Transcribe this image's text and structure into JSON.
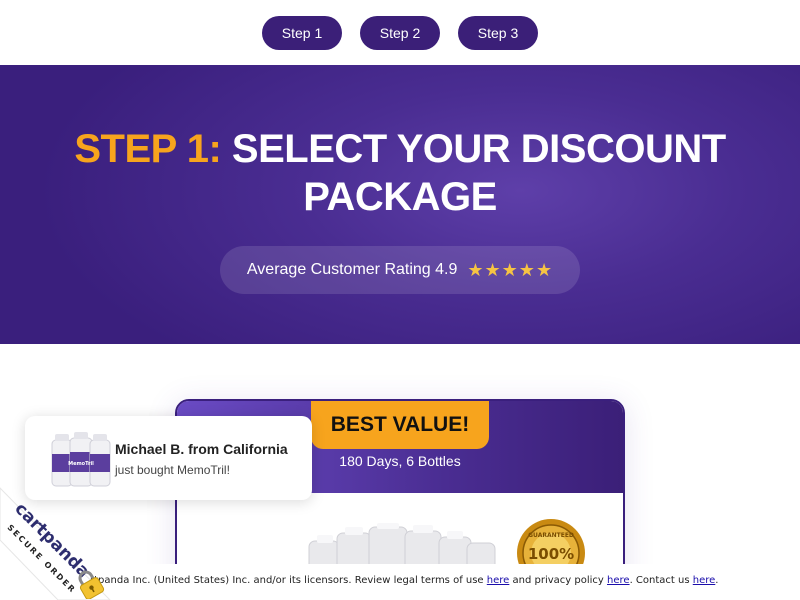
{
  "steps": [
    "Step 1",
    "Step 2",
    "Step 3"
  ],
  "hero": {
    "title_accent": "STEP 1:",
    "title_line1": "SELECT YOUR DISCOUNT",
    "title_line2": "PACKAGE",
    "rating_label": "Average Customer Rating 4.9",
    "rating_value": 4.9,
    "rating_stars": "★★★★★"
  },
  "card": {
    "badge": "BEST VALUE!",
    "subtitle": "180 Days, 6 Bottles",
    "seal_top": "GUARANTEED",
    "seal_center": "100%"
  },
  "popup": {
    "name": "Michael B. from California",
    "message": "just bought MemoTril!",
    "product_label": "MemoTril"
  },
  "footer": {
    "text_1": "rtpanda Inc. (United States) Inc. and/or its licensors. Review legal terms of use",
    "link_terms": "here",
    "text_2": "and privacy policy",
    "link_privacy": "here",
    "text_3": ". Contact us",
    "link_contact": "here",
    "text_4": "."
  },
  "ribbon": {
    "brand": "cartpanda",
    "tagline": "SECURE ORDER"
  },
  "colors": {
    "brand_purple": "#3b1f78",
    "accent_orange": "#f7a41d",
    "star_gold": "#f6c343",
    "link_blue": "#1a0dab"
  },
  "icons": [
    "star-icon",
    "lock-icon",
    "guarantee-seal-icon"
  ]
}
